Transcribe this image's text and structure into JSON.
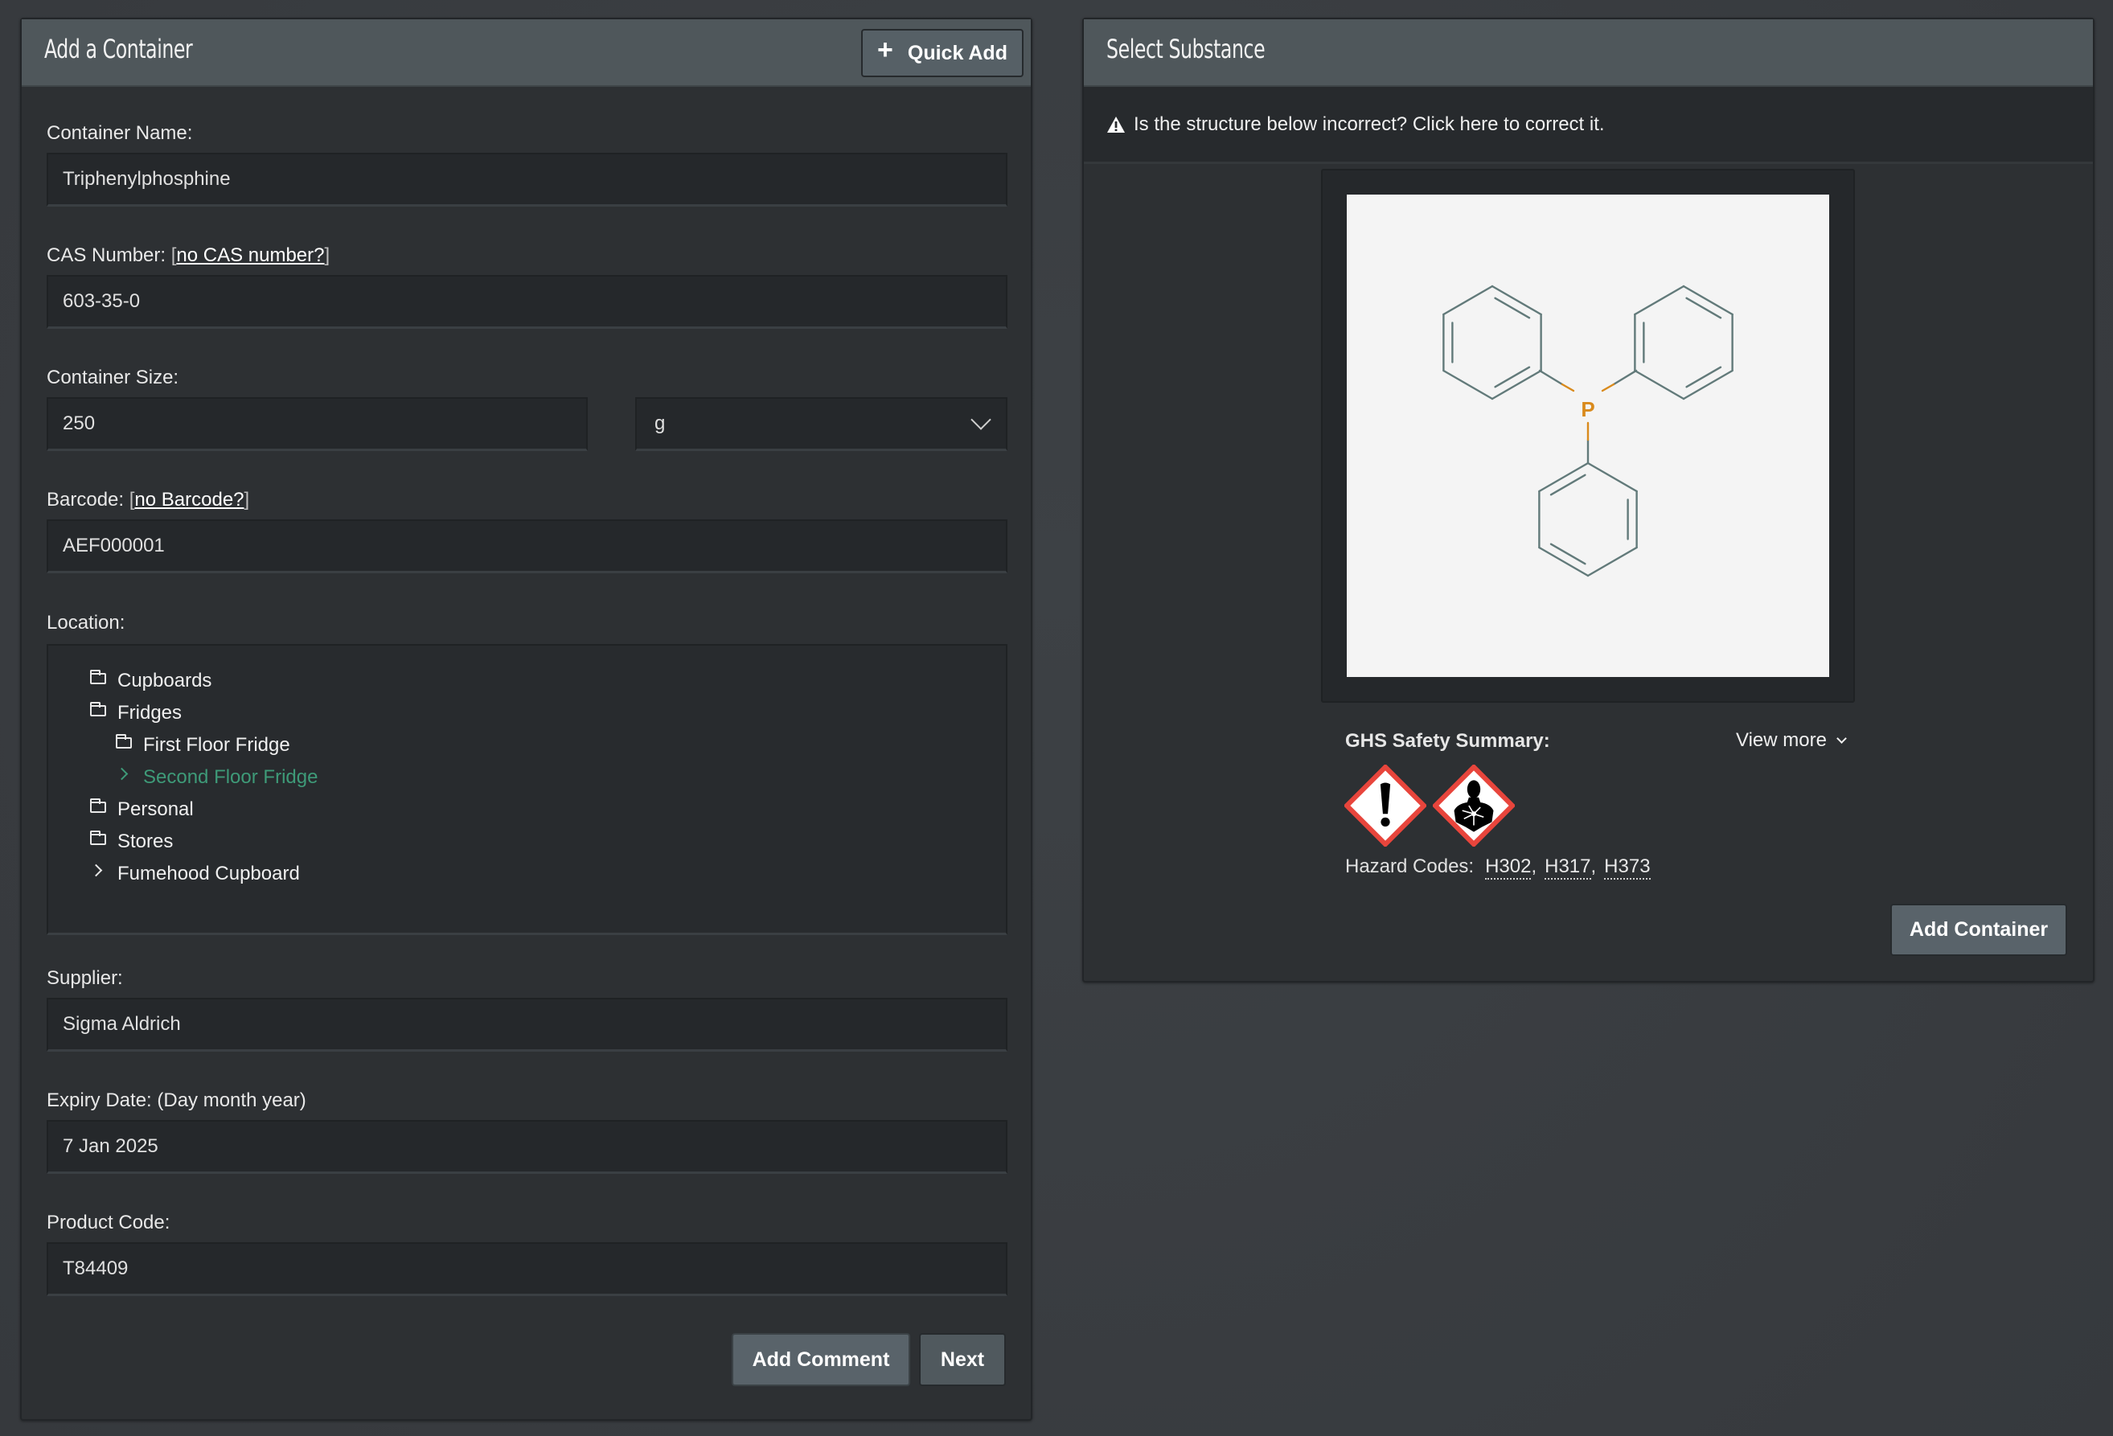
{
  "left_panel": {
    "title": "Add a Container",
    "quick_add_label": "Quick Add",
    "fields": {
      "container_name": {
        "label": "Container Name:",
        "value": "Triphenylphosphine"
      },
      "cas_number": {
        "label": "CAS Number:",
        "link": "no CAS number?",
        "value": "603-35-0"
      },
      "container_size": {
        "label": "Container Size:",
        "value": "250",
        "unit": "g"
      },
      "barcode": {
        "label": "Barcode:",
        "link": "no Barcode?",
        "value": "AEF000001"
      },
      "location": {
        "label": "Location:",
        "tree": [
          {
            "label": "Cupboards",
            "icon": "folder",
            "level": 0
          },
          {
            "label": "Fridges",
            "icon": "folder",
            "level": 0
          },
          {
            "label": "First Floor Fridge",
            "icon": "folder",
            "level": 1
          },
          {
            "label": "Second Floor Fridge",
            "icon": "chevron-right",
            "level": 1,
            "selected": true
          },
          {
            "label": "Personal",
            "icon": "folder",
            "level": 0
          },
          {
            "label": "Stores",
            "icon": "folder",
            "level": 0
          },
          {
            "label": "Fumehood Cupboard",
            "icon": "chevron-right",
            "level": 0
          }
        ]
      },
      "supplier": {
        "label": "Supplier:",
        "value": "Sigma Aldrich"
      },
      "expiry_date": {
        "label": "Expiry Date: (Day month year)",
        "value": "7 Jan 2025"
      },
      "product_code": {
        "label": "Product Code:",
        "value": "T84409"
      }
    },
    "buttons": {
      "add_comment": "Add Comment",
      "next": "Next"
    }
  },
  "right_panel": {
    "title": "Select Substance",
    "alert": "Is the structure below incorrect? Click here to correct it.",
    "structure": {
      "substance": "Triphenylphosphine",
      "center_atom": "P",
      "atom_color": "#d98a1c",
      "bond_color": "#627a7a"
    },
    "ghs": {
      "title": "GHS Safety Summary:",
      "view_more": "View more",
      "pictograms": [
        "exclamation-mark",
        "health-hazard"
      ],
      "hazard_label": "Hazard Codes:",
      "hazard_codes": [
        "H302",
        "H317",
        "H373"
      ]
    },
    "add_container_label": "Add Container"
  },
  "colors": {
    "selected_location": "#3e9a78",
    "ghs_border": "#e8453c"
  }
}
